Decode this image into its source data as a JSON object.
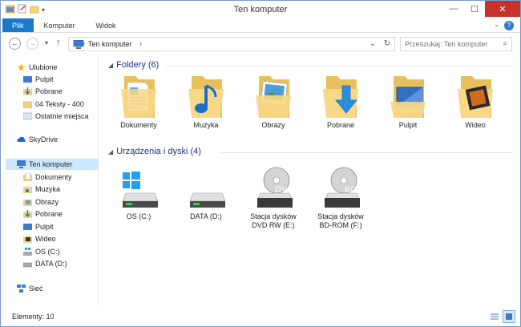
{
  "window": {
    "title": "Ten komputer"
  },
  "ribbon": {
    "tabs": [
      "Plik",
      "Komputer",
      "Widok"
    ]
  },
  "addressbar": {
    "crumb": "Ten komputer",
    "search_placeholder": "Przeszukaj: Ten komputer"
  },
  "navpane": {
    "favorites": {
      "label": "Ulubione",
      "items": [
        "Pulpit",
        "Pobrane",
        "04 Teksty - 400",
        "Ostatnie miejsca"
      ]
    },
    "skydrive": "SkyDrive",
    "computer": {
      "label": "Ten komputer",
      "items": [
        "Dokumenty",
        "Muzyka",
        "Obrazy",
        "Pobrane",
        "Pulpit",
        "Wideo",
        "OS (C:)",
        "DATA (D:)"
      ]
    },
    "network": "Sieć"
  },
  "content": {
    "folders_header": "Foldery (6)",
    "folders": [
      "Dokumenty",
      "Muzyka",
      "Obrazy",
      "Pobrane",
      "Pulpit",
      "Wideo"
    ],
    "drives_header": "Urządzenia i dyski (4)",
    "drives": [
      {
        "line1": "OS (C:)",
        "line2": ""
      },
      {
        "line1": "DATA (D:)",
        "line2": ""
      },
      {
        "line1": "Stacja dysków",
        "line2": "DVD RW (E:)",
        "badge": "DVD"
      },
      {
        "line1": "Stacja dysków",
        "line2": "BD-ROM (F:)",
        "badge": "BD"
      }
    ]
  },
  "status": {
    "count": "Elementy: 10"
  },
  "colors": {
    "accent": "#1979ca",
    "header": "#1e3287",
    "folder": "#f4d27a",
    "close": "#c7302b"
  }
}
